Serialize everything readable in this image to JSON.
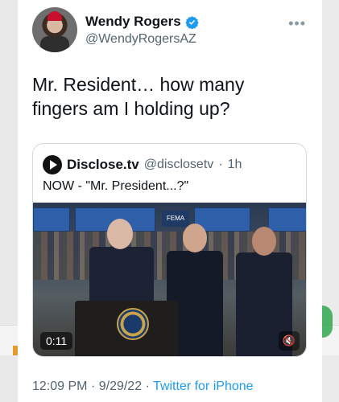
{
  "tweet": {
    "author_name": "Wendy Rogers",
    "author_handle": "@WendyRogersAZ",
    "text_line1": "Mr. Resident… how many",
    "text_line2": "fingers am I holding up?",
    "time": "12:09 PM",
    "date": "9/29/22",
    "source": "Twitter for iPhone",
    "separator": "·"
  },
  "quoted_tweet": {
    "author_name": "Disclose.tv",
    "author_handle": "@disclosetv",
    "age": "1h",
    "text": "NOW - \"Mr. President...?\"",
    "video_duration": "0:11",
    "sign_text": "FEMA"
  },
  "icons": {
    "verified": "verified-badge-icon",
    "more": "more-icon",
    "mute": "mute-icon",
    "logo": "disclose-logo-icon"
  },
  "colors": {
    "link": "#1d9bf0",
    "secondary_text": "#536471",
    "primary_text": "#0f1419",
    "border": "#cfd9de"
  }
}
